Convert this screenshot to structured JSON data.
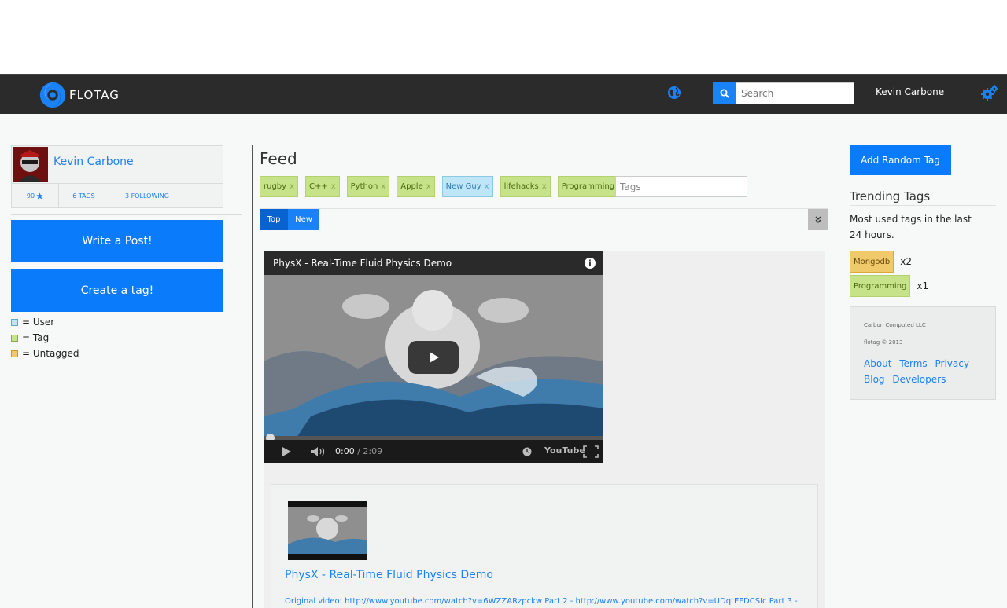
{
  "navbar": {
    "brand": "FLOTAG",
    "search_placeholder": "Search",
    "user_name": "Kevin Carbone"
  },
  "profile": {
    "name": "Kevin Carbone",
    "stars": "90",
    "tags": "6 TAGS",
    "following": "3 FOLLOWING"
  },
  "actions": {
    "write_post": "Write a Post!",
    "create_tag": "Create a tag!"
  },
  "legend": [
    {
      "label": "= User",
      "color": "#bfe6f6"
    },
    {
      "label": "= Tag",
      "color": "#c7e389"
    },
    {
      "label": "= Untagged",
      "color": "#f0c96a"
    }
  ],
  "feed": {
    "title": "Feed",
    "tags": [
      {
        "label": "rugby",
        "kind": "tag"
      },
      {
        "label": "C++",
        "kind": "tag"
      },
      {
        "label": "Python",
        "kind": "tag"
      },
      {
        "label": "Apple",
        "kind": "tag"
      },
      {
        "label": "New Guy",
        "kind": "user"
      },
      {
        "label": "lifehacks",
        "kind": "tag"
      },
      {
        "label": "Programming",
        "kind": "tag"
      }
    ],
    "remove_mark": "x",
    "tags_placeholder": "Tags",
    "sort_top": "Top",
    "sort_new": "New"
  },
  "post": {
    "video_title": "PhysX - Real-Time Fluid Physics Demo",
    "time_current": "0:00",
    "time_total": "/ 2:09",
    "youtube": "YouTube",
    "title": "PhysX - Real-Time Fluid Physics Demo",
    "description": "Original video: http://www.youtube.com/watch?v=6WZZARzpckw Part 2 - http://www.youtube.com/watch?v=UDqtEFDCSIc Part 3 -"
  },
  "sidebar": {
    "add_random": "Add Random Tag",
    "trending_title": "Trending Tags",
    "trending_desc": "Most used tags in the last 24 hours.",
    "trending": [
      {
        "label": "Mongodb",
        "count": "x2",
        "kind": "untagged"
      },
      {
        "label": "Programming",
        "count": "x1",
        "kind": "tag"
      }
    ]
  },
  "footer": {
    "company": "Carbon Computed LLC",
    "copyright": "flotag © 2013",
    "links": [
      "About",
      "Terms",
      "Privacy",
      "Blog",
      "Developers"
    ]
  }
}
